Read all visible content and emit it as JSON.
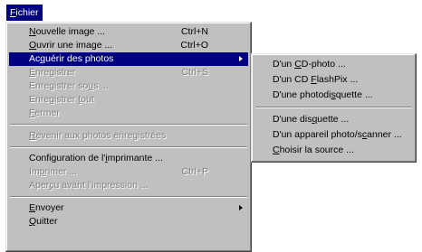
{
  "menubar": {
    "fichier_prefix": "F",
    "fichier_rest": "ichier"
  },
  "main_menu": {
    "nouvelle_image": {
      "u": "N",
      "rest": "ouvelle image ...",
      "accel": "Ctrl+N"
    },
    "ouvrir_image": {
      "u": "O",
      "rest": "uvrir une image ...",
      "accel": "Ctrl+O"
    },
    "acquerir": {
      "a": "Ac",
      "u": "q",
      "rest": "uérir des photos"
    },
    "enregistrer": {
      "u": "E",
      "rest": "nregistrer",
      "accel": "Ctrl+S"
    },
    "enregistrer_sous": {
      "a": "Enregistrer so",
      "u": "u",
      "rest": "s ..."
    },
    "enregistrer_tout": {
      "a": "Enregistrer ",
      "u": "t",
      "rest": "out"
    },
    "fermer": {
      "u": "F",
      "rest": "ermer"
    },
    "revenir": {
      "u": "R",
      "rest": "evenir aux photos enregistrées"
    },
    "configuration": {
      "a": "Configuration de l'",
      "u": "i",
      "rest": "mprimante ..."
    },
    "imprimer": {
      "a": "Im",
      "u": "p",
      "rest": "rimer ...",
      "accel": "Ctrl+P"
    },
    "apercu": {
      "a": "Aper",
      "u": "ç",
      "rest": "u avant l'impression ..."
    },
    "envoyer": {
      "u": "E",
      "rest": "nvoyer"
    },
    "quitter": {
      "u": "Q",
      "rest": "uitter"
    }
  },
  "sub_menu": {
    "cd_photo": {
      "a": "D'un ",
      "u": "C",
      "rest": "D-photo ..."
    },
    "cd_flashpix": {
      "a": "D'un CD ",
      "u": "F",
      "rest": "lashPix ..."
    },
    "photodisquette": {
      "a": "D'une photodi",
      "u": "s",
      "rest": "quette ..."
    },
    "disquette": {
      "a": "D'une dis",
      "u": "q",
      "rest": "uette ..."
    },
    "appareil": {
      "a": "D'un appareil photo/s",
      "u": "c",
      "rest": "anner ..."
    },
    "choisir_source": {
      "u": "C",
      "rest": "hoisir la source ..."
    }
  },
  "colors": {
    "menu_bg": "#c0c0c0",
    "highlight": "#000080",
    "disabled": "#808080"
  }
}
